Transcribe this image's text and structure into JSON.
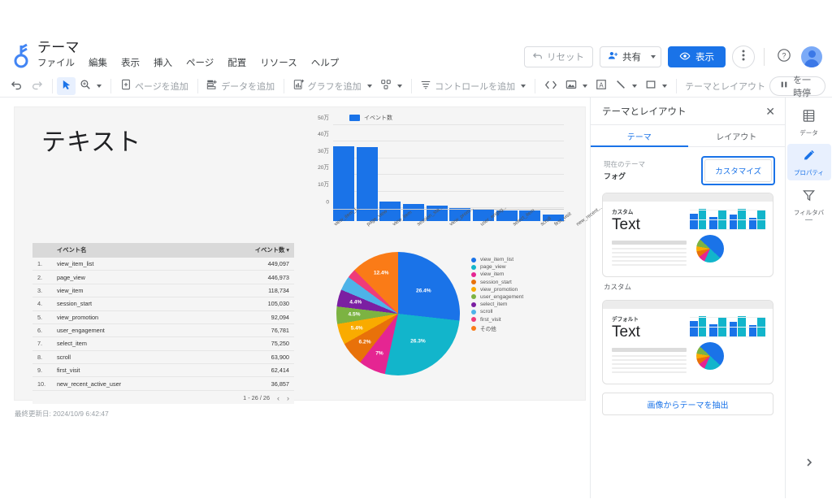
{
  "header": {
    "logo_icon": "looker-studio-logo-icon",
    "doc_title": "テーマ",
    "menus": [
      "ファイル",
      "編集",
      "表示",
      "挿入",
      "ページ",
      "配置",
      "リソース",
      "ヘルプ"
    ],
    "reset_label": "リセット",
    "reset_icon": "undo-arrow-icon",
    "share_label": "共有",
    "share_icon": "person-add-icon",
    "share_caret_icon": "caret-down-icon",
    "view_label": "表示",
    "view_icon": "eye-icon",
    "more_icon": "more-vert-icon",
    "help_icon": "help-circle-icon",
    "avatar_icon": "user-avatar"
  },
  "toolbar": {
    "undo_icon": "undo-icon",
    "redo_icon": "redo-icon",
    "select_icon": "cursor-arrow-icon",
    "zoom_icon": "magnifier-icon",
    "add_page_label": "ページを追加",
    "add_page_icon": "page-plus-icon",
    "add_data_label": "データを追加",
    "add_data_icon": "data-plus-icon",
    "add_chart_label": "グラフを追加",
    "add_chart_icon": "chart-plus-icon",
    "community_viz_icon": "community-viz-icon",
    "add_control_label": "コントロールを追加",
    "add_control_icon": "control-plus-icon",
    "embed_icon": "embed-code-icon",
    "image_icon": "image-icon",
    "textbox_icon": "text-box-icon",
    "line_icon": "line-icon",
    "shape_icon": "rectangle-icon",
    "theme_layout_label": "テーマとレイアウト",
    "pause_label": "更新を一時停止",
    "pause_icon": "pause-icon"
  },
  "canvas": {
    "report_heading": "テキスト",
    "last_update": "最終更新日: 2024/10/9 6:42:47"
  },
  "table": {
    "columns": [
      "",
      "イベント名",
      "イベント数"
    ],
    "sort_caret_icon": "caret-down-icon",
    "rows": [
      {
        "rank": "1.",
        "name": "view_item_list",
        "count": "449,097"
      },
      {
        "rank": "2.",
        "name": "page_view",
        "count": "446,973"
      },
      {
        "rank": "3.",
        "name": "view_item",
        "count": "118,734"
      },
      {
        "rank": "4.",
        "name": "session_start",
        "count": "105,030"
      },
      {
        "rank": "5.",
        "name": "view_promotion",
        "count": "92,094"
      },
      {
        "rank": "6.",
        "name": "user_engagement",
        "count": "76,781"
      },
      {
        "rank": "7.",
        "name": "select_item",
        "count": "75,250"
      },
      {
        "rank": "8.",
        "name": "scroll",
        "count": "63,900"
      },
      {
        "rank": "9.",
        "name": "first_visit",
        "count": "62,414"
      },
      {
        "rank": "10.",
        "name": "new_recent_active_user",
        "count": "36,857"
      }
    ],
    "pagination": "1 - 26 / 26",
    "prev_icon": "chevron-left-icon",
    "next_icon": "chevron-right-icon"
  },
  "chart_data": [
    {
      "type": "bar",
      "title": "",
      "legend": [
        "イベント数"
      ],
      "legend_position": "top-left",
      "grid": true,
      "xlabel": "",
      "ylabel": "",
      "ylim": [
        0,
        500000
      ],
      "ytick_labels": [
        "0",
        "10万",
        "20万",
        "30万",
        "40万",
        "50万"
      ],
      "ytick_values": [
        0,
        100000,
        200000,
        300000,
        400000,
        500000
      ],
      "categories": [
        "view_item_l...",
        "page_view",
        "view_item",
        "session_sta...",
        "view_prom...",
        "user_engag...",
        "select_item",
        "scroll",
        "first_visit",
        "new_recent..."
      ],
      "values": [
        449097,
        446973,
        118734,
        105030,
        92094,
        76781,
        75250,
        63900,
        62414,
        36857
      ],
      "series_color": "#1a73e8"
    },
    {
      "type": "pie",
      "title": "",
      "legend_position": "right",
      "labels": [
        "view_item_list",
        "page_view",
        "view_item",
        "session_start",
        "view_promotion",
        "user_engagement",
        "select_item",
        "scroll",
        "first_visit",
        "その他"
      ],
      "values": [
        26.4,
        26.3,
        7.0,
        6.2,
        5.4,
        4.5,
        4.4,
        3.7,
        2.3,
        12.4
      ],
      "value_labels": [
        "26.4%",
        "26.3%",
        "7%",
        "6.2%",
        "5.4%",
        "4.5%",
        "4.4%",
        "",
        "",
        "12.4%"
      ],
      "colors": [
        "#1a73e8",
        "#12b5cb",
        "#e52592",
        "#e8710a",
        "#f9ab00",
        "#7cb342",
        "#7b1fa2",
        "#4eb3e8",
        "#ef3c79",
        "#fa7b17"
      ]
    }
  ],
  "panel": {
    "title": "テーマとレイアウト",
    "close_icon": "close-icon",
    "tabs": [
      {
        "label": "テーマ",
        "active": true
      },
      {
        "label": "レイアウト",
        "active": false
      }
    ],
    "current_theme_label": "現在のテーマ",
    "current_theme_value": "フォグ",
    "customize_label": "カスタマイズ",
    "theme_cards": [
      {
        "kicker": "カスタム",
        "text": "Text",
        "name": "カスタム"
      },
      {
        "kicker": "デフォルト",
        "text": "Text",
        "name": ""
      }
    ],
    "extract_label": "画像からテーマを抽出"
  },
  "rail": {
    "items": [
      {
        "label": "データ",
        "icon": "data-table-icon",
        "active": false,
        "truncated": false
      },
      {
        "label": "プロパティ",
        "icon": "pencil-icon",
        "active": true,
        "truncated": false
      },
      {
        "label": "フィルタバ",
        "icon": "filter-funnel-icon",
        "active": false,
        "truncated": true
      }
    ],
    "expand_icon": "chevron-right-icon"
  },
  "colors": {
    "accent": "#1a73e8",
    "teal": "#12b5cb",
    "panel_border": "#e8eaed"
  }
}
